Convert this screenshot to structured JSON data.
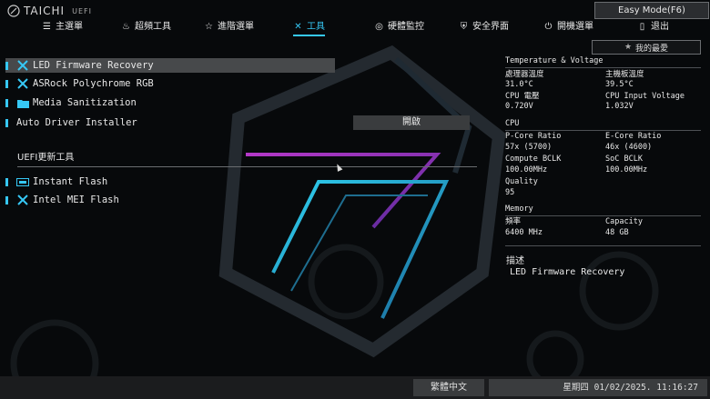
{
  "header": {
    "brand": "TAICHI",
    "uefi_label": "UEFI",
    "easy_mode": "Easy Mode(F6)"
  },
  "nav": [
    {
      "label": "主選單",
      "icon": "list-icon"
    },
    {
      "label": "超頻工具",
      "icon": "flame-icon"
    },
    {
      "label": "進階選單",
      "icon": "star-icon"
    },
    {
      "label": "工具",
      "icon": "tools-icon",
      "active": true
    },
    {
      "label": "硬體監控",
      "icon": "monitor-icon"
    },
    {
      "label": "安全界面",
      "icon": "shield-icon"
    },
    {
      "label": "開機選單",
      "icon": "power-icon"
    },
    {
      "label": "退出",
      "icon": "exit-icon"
    }
  ],
  "favorite": "我的最愛",
  "menu": [
    {
      "label": "LED Firmware Recovery",
      "icon": "tools-icon",
      "selected": true
    },
    {
      "label": "ASRock Polychrome RGB",
      "icon": "tools-icon"
    },
    {
      "label": "Media Sanitization",
      "icon": "folder-icon"
    },
    {
      "label": "Auto Driver Installer",
      "icon": ""
    }
  ],
  "open_button": "開啟",
  "uefi_update_section": "UEFI更新工具",
  "update_items": [
    {
      "label": "Instant Flash",
      "icon": "bios-chip-icon"
    },
    {
      "label": "Intel MEI Flash",
      "icon": "tools-icon"
    }
  ],
  "info": {
    "temp_title": "Temperature & Voltage",
    "cpu_temp_label": "處理器溫度",
    "cpu_temp": "31.0°C",
    "mb_temp_label": "主機板溫度",
    "mb_temp": "39.5°C",
    "cpu_volt_label": "CPU 電壓",
    "cpu_volt": "0.720V",
    "cpu_input_label": "CPU Input Voltage",
    "cpu_input": "1.032V",
    "cpu_title": "CPU",
    "pcore_label": "P-Core Ratio",
    "pcore": "57x (5700)",
    "ecore_label": "E-Core Ratio",
    "ecore": "46x (4600)",
    "compute_label": "Compute BCLK",
    "compute": "100.00MHz",
    "soc_label": "SoC BCLK",
    "soc": "100.00MHz",
    "quality_label": "Quality",
    "quality": "95",
    "memory_title": "Memory",
    "freq_label": "頻率",
    "freq": "6400 MHz",
    "cap_label": "Capacity",
    "cap": "48 GB"
  },
  "description": {
    "title": "描述",
    "text": "LED Firmware Recovery"
  },
  "footer": {
    "language": "繁體中文",
    "datetime": "星期四 01/02/2025. 11:16:27"
  },
  "colors": {
    "accent": "#36c8f5",
    "selection": "#47494b",
    "background": "#07090b"
  }
}
